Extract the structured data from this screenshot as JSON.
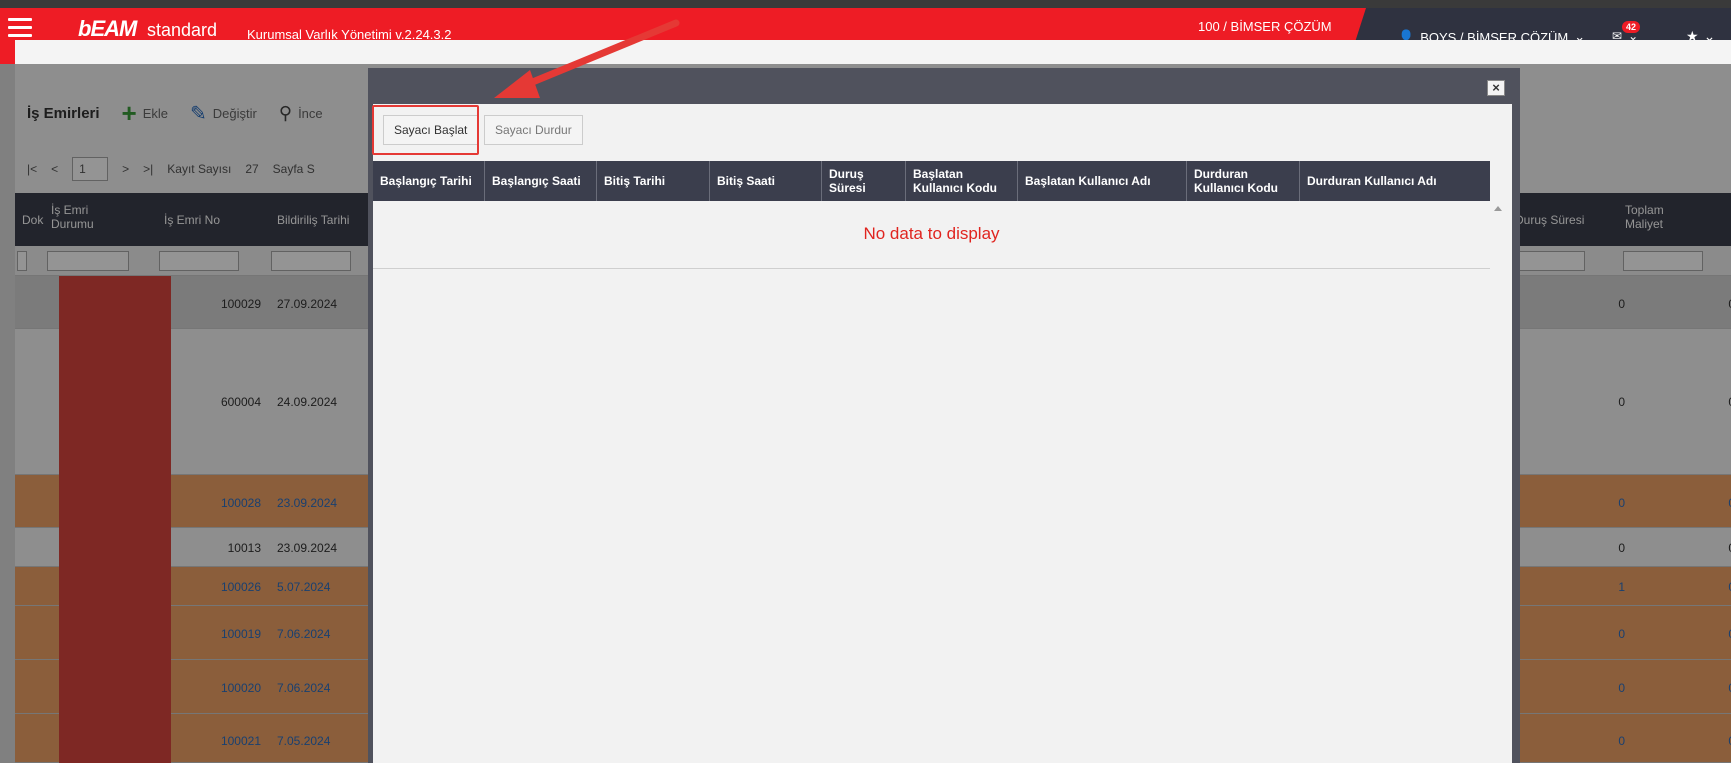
{
  "header": {
    "logo_beam": "bEAM",
    "logo_suffix": "standard",
    "app_title": "Kurumsal Varlık Yönetimi v.2.24.3.2",
    "company": "100 / BİMSER ÇÖZÜM",
    "user": "BOYS / BİMSER ÇÖZÜM",
    "mail_badge": "42",
    "brand_color": "#ee1c25"
  },
  "background_page": {
    "title": "İş Emirleri",
    "toolbar": {
      "add": "Ekle",
      "edit": "Değiştir",
      "view": "İnce"
    },
    "pager": {
      "page": "1",
      "record_count_label": "Kayıt Sayısı",
      "record_count": "27",
      "page_size_label": "Sayfa S"
    },
    "columns": [
      "Dok",
      "İş Emri Durumu",
      "İş Emri No",
      "Bildiriliş Tarihi",
      "Duruş Süresi",
      "Toplam Maliyet"
    ],
    "rows": [
      {
        "no": "100029",
        "date": "27.09.2024",
        "durus": "0",
        "maliyet": "0"
      },
      {
        "no": "600004",
        "date": "24.09.2024",
        "durus": "0",
        "maliyet": "0"
      },
      {
        "no": "100028",
        "date": "23.09.2024",
        "durus": "0",
        "maliyet": "0"
      },
      {
        "no": "10013",
        "date": "23.09.2024",
        "durus": "0",
        "maliyet": "0"
      },
      {
        "no": "100026",
        "date": "5.07.2024",
        "durus": "1",
        "maliyet": "0"
      },
      {
        "no": "100019",
        "date": "7.06.2024",
        "durus": "0",
        "maliyet": "0"
      },
      {
        "no": "100020",
        "date": "7.06.2024",
        "durus": "0",
        "maliyet": "0"
      },
      {
        "no": "100021",
        "date": "7.05.2024",
        "durus": "0",
        "maliyet": "0"
      }
    ]
  },
  "modal": {
    "close_label": "×",
    "start_button": "Sayacı Başlat",
    "stop_button": "Sayacı Durdur",
    "columns": [
      "Başlangıç Tarihi",
      "Başlangıç Saati",
      "Bitiş Tarihi",
      "Bitiş Saati",
      "Duruş Süresi",
      "Başlatan Kullanıcı Kodu",
      "Başlatan Kullanıcı Adı",
      "Durduran Kullanıcı Kodu",
      "Durduran Kullanıcı Adı"
    ],
    "empty_message": "No data to display"
  }
}
